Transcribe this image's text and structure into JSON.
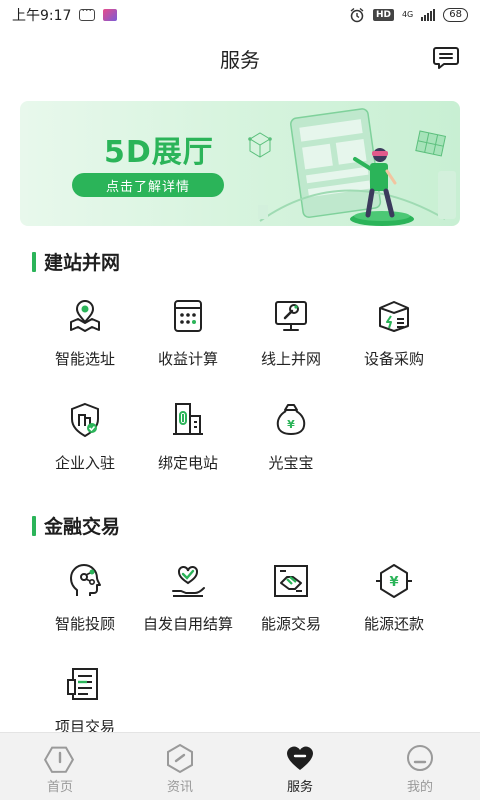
{
  "status": {
    "time": "上午9:17",
    "network": "4G",
    "battery": "68"
  },
  "header": {
    "title": "服务"
  },
  "banner": {
    "title": "5D展厅",
    "cta": "点击了解详情"
  },
  "sections": [
    {
      "title": "建站并网",
      "items": [
        {
          "label": "智能选址",
          "icon": "location-map-icon"
        },
        {
          "label": "收益计算",
          "icon": "calculator-icon"
        },
        {
          "label": "线上并网",
          "icon": "monitor-wrench-icon"
        },
        {
          "label": "设备采购",
          "icon": "box-icon"
        },
        {
          "label": "企业入驻",
          "icon": "shield-company-icon"
        },
        {
          "label": "绑定电站",
          "icon": "building-link-icon"
        },
        {
          "label": "光宝宝",
          "icon": "money-bag-icon"
        }
      ]
    },
    {
      "title": "金融交易",
      "items": [
        {
          "label": "智能投顾",
          "icon": "head-gear-icon"
        },
        {
          "label": "自发自用结算",
          "icon": "hand-heart-icon"
        },
        {
          "label": "能源交易",
          "icon": "handshake-icon"
        },
        {
          "label": "能源还款",
          "icon": "hexagon-yen-icon"
        },
        {
          "label": "项目交易",
          "icon": "document-icon"
        }
      ]
    }
  ],
  "tabbar": [
    {
      "label": "首页",
      "icon": "home-icon",
      "active": false
    },
    {
      "label": "资讯",
      "icon": "news-icon",
      "active": false
    },
    {
      "label": "服务",
      "icon": "heart-service-icon",
      "active": true
    },
    {
      "label": "我的",
      "icon": "profile-icon",
      "active": false
    }
  ],
  "colors": {
    "accent": "#2bb459",
    "text": "#222222",
    "tab_inactive": "#9a9a9a"
  }
}
